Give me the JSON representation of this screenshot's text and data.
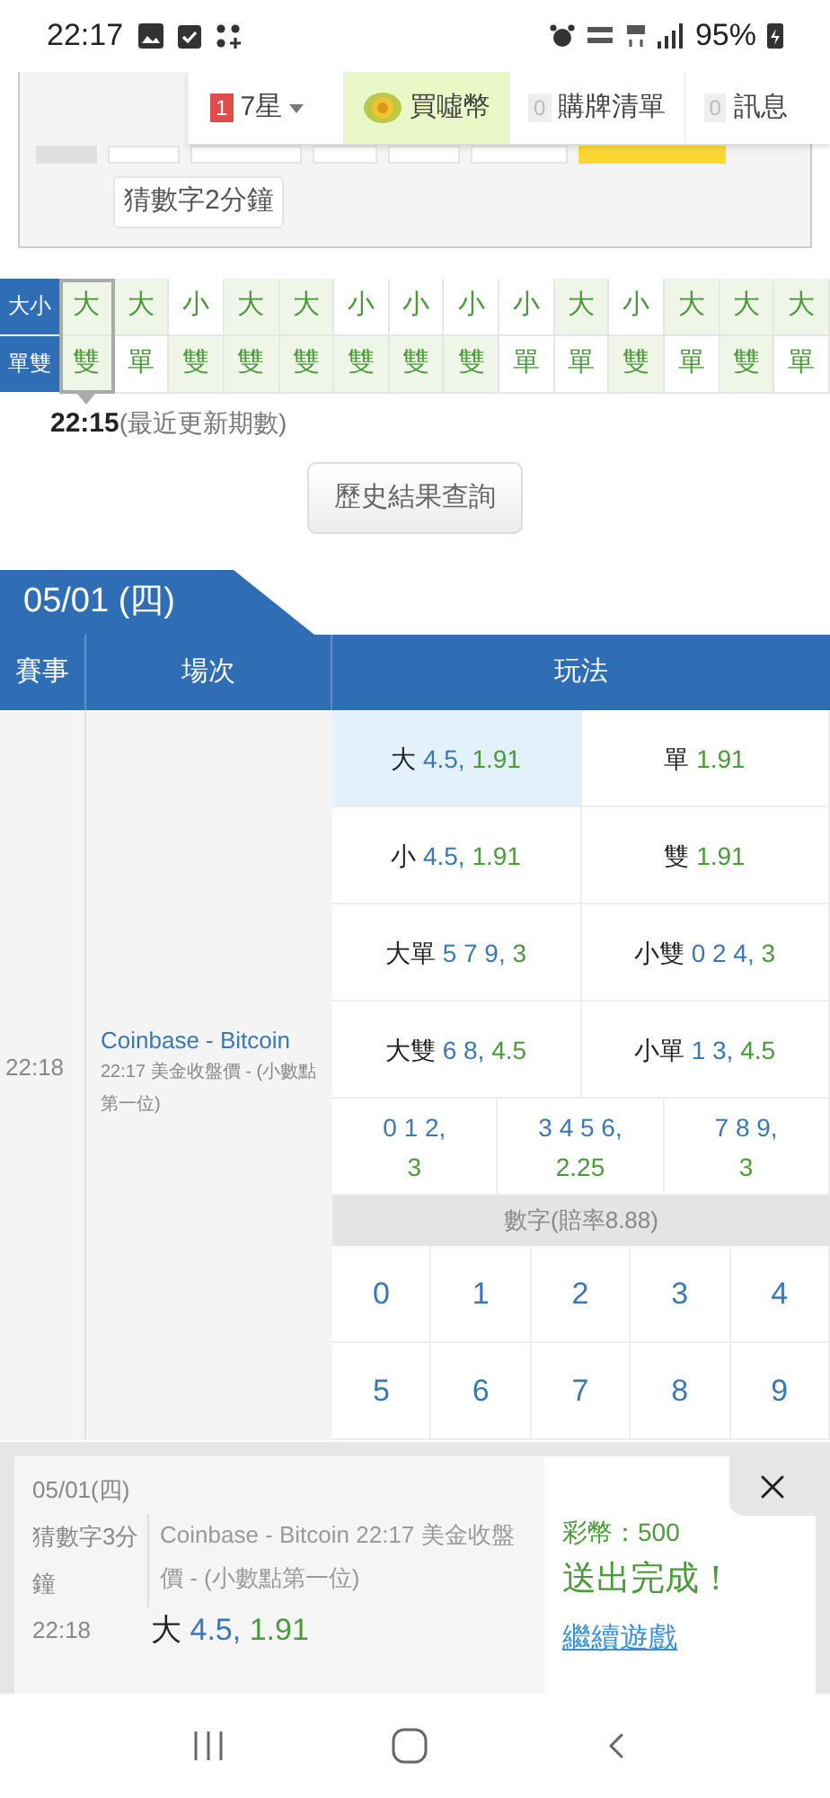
{
  "status_bar": {
    "time": "22:17",
    "battery": "95%"
  },
  "nav": {
    "items": [
      {
        "kind": "dropdown",
        "badge": "1",
        "color": "#e04b4b",
        "label": "7星",
        "selected": false
      },
      {
        "kind": "coin",
        "label": "買噓幣",
        "selected": true
      },
      {
        "kind": "plain",
        "badge": "0",
        "color": "#eeeeee",
        "label": "購牌清單",
        "selected": false
      },
      {
        "kind": "plain",
        "badge": "0",
        "color": "#eeeeee",
        "label": "訊息",
        "selected": false
      }
    ]
  },
  "categories": [
    {
      "label": "猜數字2分鐘",
      "selected": false
    }
  ],
  "results": {
    "row_labels": [
      "大小",
      "單雙"
    ],
    "columns": [
      {
        "selected": true,
        "cells": [
          {
            "text": "大",
            "tinted": true
          },
          {
            "text": "雙",
            "tinted": true
          }
        ]
      },
      {
        "selected": false,
        "cells": [
          {
            "text": "大",
            "tinted": true
          },
          {
            "text": "單",
            "tinted": false
          }
        ]
      },
      {
        "selected": false,
        "cells": [
          {
            "text": "小",
            "tinted": false
          },
          {
            "text": "雙",
            "tinted": true
          }
        ]
      },
      {
        "selected": false,
        "cells": [
          {
            "text": "大",
            "tinted": true
          },
          {
            "text": "雙",
            "tinted": true
          }
        ]
      },
      {
        "selected": false,
        "cells": [
          {
            "text": "大",
            "tinted": true
          },
          {
            "text": "雙",
            "tinted": true
          }
        ]
      },
      {
        "selected": false,
        "cells": [
          {
            "text": "小",
            "tinted": false
          },
          {
            "text": "雙",
            "tinted": true
          }
        ]
      },
      {
        "selected": false,
        "cells": [
          {
            "text": "小",
            "tinted": false
          },
          {
            "text": "雙",
            "tinted": true
          }
        ]
      },
      {
        "selected": false,
        "cells": [
          {
            "text": "小",
            "tinted": false
          },
          {
            "text": "雙",
            "tinted": true
          }
        ]
      },
      {
        "selected": false,
        "cells": [
          {
            "text": "小",
            "tinted": false
          },
          {
            "text": "單",
            "tinted": false
          }
        ]
      },
      {
        "selected": false,
        "cells": [
          {
            "text": "大",
            "tinted": true
          },
          {
            "text": "單",
            "tinted": false
          }
        ]
      },
      {
        "selected": false,
        "cells": [
          {
            "text": "小",
            "tinted": false
          },
          {
            "text": "雙",
            "tinted": true
          }
        ]
      },
      {
        "selected": false,
        "cells": [
          {
            "text": "大",
            "tinted": true
          },
          {
            "text": "單",
            "tinted": false
          }
        ]
      },
      {
        "selected": false,
        "cells": [
          {
            "text": "大",
            "tinted": true
          },
          {
            "text": "雙",
            "tinted": true
          }
        ]
      },
      {
        "selected": false,
        "cells": [
          {
            "text": "大",
            "tinted": true
          },
          {
            "text": "單",
            "tinted": false
          }
        ]
      }
    ]
  },
  "latest": {
    "time": "22:15",
    "note": "(最近更新期數)"
  },
  "history_button": "歷史結果查詢",
  "match": {
    "date_tab": "05/01 (四)",
    "columns": [
      "賽事",
      "場次",
      "玩法"
    ],
    "time": "22:18",
    "title": "Coinbase - Bitcoin",
    "subtitle": "22:17 美金收盤價 - (小數點第一位)",
    "bet_rows": [
      [
        {
          "label": "大",
          "line": "4.5,",
          "odds": "1.91",
          "selected": true
        },
        {
          "label": "單",
          "odds": "1.91",
          "selected": false
        }
      ],
      [
        {
          "label": "小",
          "line": "4.5,",
          "odds": "1.91",
          "selected": false
        },
        {
          "label": "雙",
          "odds": "1.91",
          "selected": false
        }
      ],
      [
        {
          "label": "大單",
          "line": "5 7 9,",
          "odds": "3",
          "selected": false
        },
        {
          "label": "小雙",
          "line": "0 2 4,",
          "odds": "3",
          "selected": false
        }
      ],
      [
        {
          "label": "大雙",
          "line": "6 8,",
          "odds": "4.5",
          "selected": false
        },
        {
          "label": "小單",
          "line": "1 3,",
          "odds": "4.5",
          "selected": false
        }
      ],
      [
        {
          "line": "0 1 2,",
          "odds": "3",
          "selected": false
        },
        {
          "line": "3 4 5 6,",
          "odds": "2.25",
          "selected": false
        },
        {
          "line": "7 8 9,",
          "odds": "3",
          "selected": false
        }
      ]
    ],
    "digits_header": "數字(賠率8.88)",
    "digits": [
      {
        "text": "0",
        "selected": false
      },
      {
        "text": "1",
        "selected": false
      },
      {
        "text": "2",
        "selected": false
      },
      {
        "text": "3",
        "selected": false
      },
      {
        "text": "4",
        "selected": false
      },
      {
        "text": "5",
        "selected": false
      },
      {
        "text": "6",
        "selected": false
      },
      {
        "text": "7",
        "selected": false
      },
      {
        "text": "8",
        "selected": false
      },
      {
        "text": "9",
        "selected": false
      }
    ]
  },
  "ticket": {
    "date": "05/01(四)",
    "game": "猜數字3分鐘",
    "time": "22:18",
    "desc": "Coinbase - Bitcoin 22:17 美金收盤價 - (小數點第一位)",
    "pick": {
      "label": "大",
      "line": "4.5,",
      "odds": "1.91"
    },
    "stake": "彩幣：500",
    "status": "送出完成！",
    "link": "繼續遊戲"
  }
}
